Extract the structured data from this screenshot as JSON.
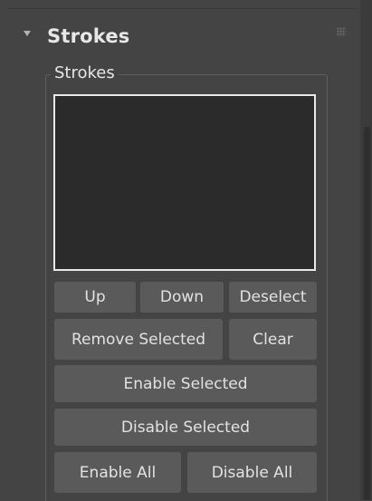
{
  "rollout": {
    "title": "Strokes",
    "collapse_icon": "triangle-down-icon",
    "grip_icon": "grip-dots-icon"
  },
  "group": {
    "label": "Strokes"
  },
  "buttons": {
    "up": "Up",
    "down": "Down",
    "deselect": "Deselect",
    "remove_selected": "Remove Selected",
    "clear": "Clear",
    "enable_selected": "Enable Selected",
    "disable_selected": "Disable Selected",
    "enable_all": "Enable All",
    "disable_all": "Disable All"
  },
  "colors": {
    "panel_bg": "#444444",
    "button_bg": "#5a5a5a",
    "list_bg": "#2b2b2b",
    "list_border": "#e9e9e9",
    "text": "#e2e2e2"
  }
}
